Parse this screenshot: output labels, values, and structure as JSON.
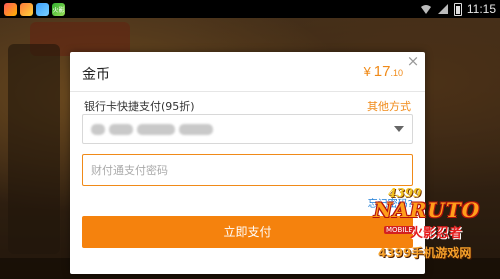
{
  "status_bar": {
    "time": "11:15",
    "notification_icons": [
      "app-icon-red",
      "app-icon-orange",
      "app-icon-blue",
      "app-icon-green"
    ],
    "notification_green_label": "火影"
  },
  "payment_dialog": {
    "product_name": "金币",
    "amount_symbol": "¥",
    "amount_integer": "17",
    "amount_decimal": ".10",
    "payment_method_label": "银行卡快捷支付(95折)",
    "other_methods_label": "其他方式",
    "password_placeholder": "财付通支付密码",
    "forgot_password_label": "忘记密码?",
    "pay_button_label": "立即支付",
    "close_label": "×"
  },
  "watermark": {
    "top_text": "4399",
    "brand": "NARUTO",
    "cn_title": "火影忍者",
    "badge": "MOBILE",
    "subtitle": "4399手机游戏网"
  },
  "colors": {
    "accent": "#f08a18",
    "pay_button": "#f5820d",
    "link": "#1a7bd6"
  }
}
